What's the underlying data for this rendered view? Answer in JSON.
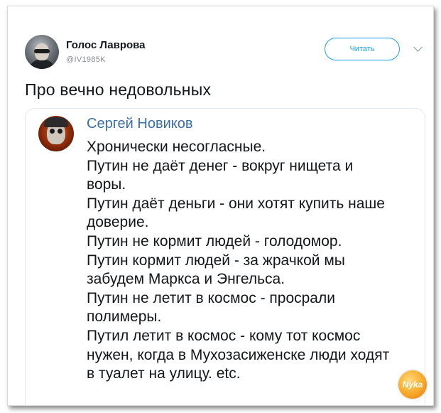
{
  "tweet": {
    "author": {
      "display_name": "Голос Лаврова",
      "handle": "@IV1985K",
      "avatar_icon": "user-avatar-icon"
    },
    "follow_label": "Читать",
    "menu_icon": "chevron-down-icon",
    "text": "Про вечно недовольных"
  },
  "quote": {
    "author_name": "Сергей Новиков",
    "avatar_icon": "skull-avatar-icon",
    "lines": [
      "Хронически несогласные.",
      "Путин не даёт денег - вокруг нищета и",
      "воры.",
      "Путин даёт деньги - они хотят купить наше",
      "доверие.",
      "Путин не кормит людей - голодомор.",
      "Путин кормит людей - за жрачкой мы",
      "забудем Маркса и Энгельса.",
      "Путин не летит в космос - просрали",
      "полимеры.",
      "Путил летит в космос - кому тот космос",
      "нужен, когда в Мухозасиженске люди ходят",
      "в туалет на улицу. etc."
    ]
  },
  "watermark": {
    "text": "Nyka"
  },
  "colors": {
    "accent": "#1da1f2",
    "quote_name": "#3b6fa3",
    "text": "#14171a",
    "muted": "#8a8f94"
  }
}
